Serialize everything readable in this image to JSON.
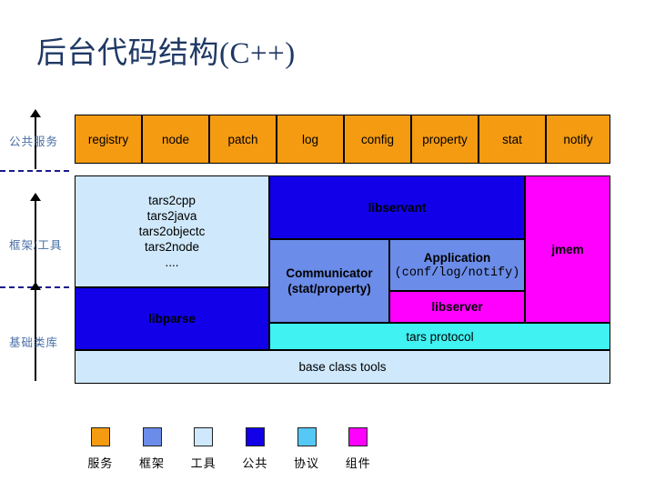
{
  "slide": {
    "title": "后台代码结构(C++)"
  },
  "axis": {
    "labels": [
      {
        "text": "公共服务"
      },
      {
        "text": "框架/工具"
      },
      {
        "text": "基础类库"
      }
    ]
  },
  "service_row": {
    "items": [
      {
        "label": "registry"
      },
      {
        "label": "node"
      },
      {
        "label": "patch"
      },
      {
        "label": "log"
      },
      {
        "label": "config"
      },
      {
        "label": "property"
      },
      {
        "label": "stat"
      },
      {
        "label": "notify"
      }
    ],
    "color": "#f59b11"
  },
  "blocks": {
    "tools": {
      "lines": [
        "tars2cpp",
        "tars2java",
        "tars2objectc",
        "tars2node",
        "...."
      ],
      "color": "#cfe8fb"
    },
    "libparse": {
      "label": "libparse",
      "color": "#1100e8"
    },
    "libservant": {
      "label": "libservant",
      "color": "#1100e8"
    },
    "communicator": {
      "line1": "Communicator",
      "line2": "(stat/property)",
      "color": "#6b8ce8"
    },
    "application": {
      "line1": "Application",
      "line2": "(conf/log/notify)",
      "color": "#6b8ce8"
    },
    "libserver": {
      "label": "libserver",
      "color": "#ff00ff"
    },
    "jmem": {
      "label": "jmem",
      "color": "#ff00ff"
    },
    "tars_protocol": {
      "label": "tars protocol",
      "color": "#40f2f2"
    },
    "base_class_tools": {
      "label": "base class tools",
      "color": "#cfe8fb"
    }
  },
  "legend": {
    "items": [
      {
        "label": "服务",
        "color": "#f59b11"
      },
      {
        "label": "框架",
        "color": "#6b8ce8"
      },
      {
        "label": "工具",
        "color": "#cfe8fb"
      },
      {
        "label": "公共",
        "color": "#1100e8"
      },
      {
        "label": "协议",
        "color": "#55c8f5"
      },
      {
        "label": "组件",
        "color": "#ff00ff"
      }
    ]
  }
}
